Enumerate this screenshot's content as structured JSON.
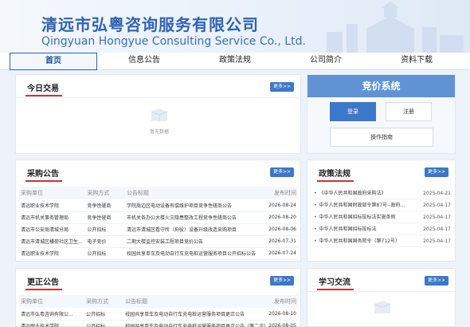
{
  "header": {
    "title_cn": "清远市弘粤咨询服务有限公司",
    "title_en": "Qingyuan Hongyue Consulting Service Co., Ltd."
  },
  "nav": {
    "items": [
      "首页",
      "信息公告",
      "政策法规",
      "公司简介",
      "资料下载"
    ],
    "active": "首页"
  },
  "today_trade": {
    "title": "今日交易",
    "more": "更多>>",
    "empty_text": "暂无数据"
  },
  "bidding": {
    "title": "竞价系统",
    "login": "登录",
    "register": "注册",
    "guide": "操作指南"
  },
  "procurement": {
    "title": "采购公告",
    "more": "更多>>",
    "columns": [
      "采购单位",
      "采购方式",
      "公告标题",
      "发布时间"
    ],
    "rows": [
      [
        "清远职业技术学院",
        "竞争性磋商",
        "学院周边区电动设备有偿维护项目竞争性磋商公告",
        "2026-08-24"
      ],
      [
        "清远市机关事务管理局",
        "竞争性磋商",
        "市机关各办公大楼火灾隐患整改工程竞争性磋商公告",
        "2026-08-20"
      ],
      [
        "清远市公安局清城分局",
        "公开招标",
        "清远市清城区看守所（拘役）设备升级改造采购项目",
        "2026-08-06"
      ],
      [
        "清远市清城区横荷社区卫生...",
        "电子竞价",
        "二期大楼监控安装工程项目竞价公告",
        "2026-07-31"
      ],
      [
        "清远职业技术学院",
        "公开招标",
        "校园共享单车及电动自行车充电桩运营服务项目公开招标公告",
        "2026-07-24"
      ]
    ]
  },
  "policy": {
    "title": "政策法规",
    "more": "更多>>",
    "items": [
      {
        "title": "《中华人民共和国政府采购法》",
        "date": "2025-04-21"
      },
      {
        "title": "中华人民共和国财政部令第87号--政府...",
        "date": "2025-04-17"
      },
      {
        "title": "中华人民共和国招标投标法实施条例",
        "date": "2025-04-17"
      },
      {
        "title": "中华人民共和国招标投标法",
        "date": "2025-04-17"
      },
      {
        "title": "中华人民共和国国务院令（第712号）",
        "date": "2025-04-17"
      }
    ]
  },
  "correction": {
    "title": "更正公告",
    "more": "更多>>",
    "columns": [
      "采购单位",
      "采购方式",
      "公告标题",
      "发布时间"
    ],
    "rows": [
      [
        "清远市弘粤咨询有限公...",
        "公开招标",
        "校园共享单车及电动自行车充电桩运营服务项目更正公告",
        "2026-08-10"
      ],
      [
        "清远职业技术学院",
        "公开招标",
        "校园共享单车及电动自行车充电桩运营服务项目更正公告（第二次）",
        "2026-08-05"
      ]
    ]
  },
  "study": {
    "title": "学习交流",
    "more": "更多>>"
  },
  "colors": {
    "brand": "#2f63b6",
    "accent_red": "#c73531",
    "button_blue": "#3c78c9"
  }
}
